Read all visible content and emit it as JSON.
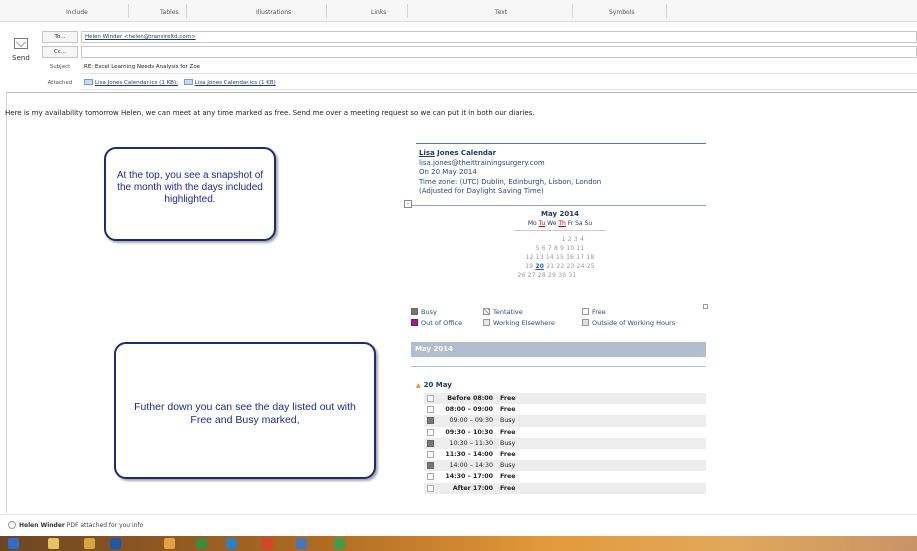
{
  "ribbon": {
    "groups": [
      "Include",
      "Tables",
      "Illustrations",
      "Links",
      "Text",
      "Symbols"
    ]
  },
  "compose": {
    "send_label": "Send",
    "to_label": "To...",
    "to_value": "Helen Winder <helen@transireltd.com>",
    "cc_label": "Cc...",
    "cc_value": "",
    "subject_label": "Subject",
    "subject_value": "RE: Excel Learning Needs Analysis for Zoe",
    "attached_label": "Attached",
    "attachments": [
      "Lisa Jones Calendar.ics (1 KB);",
      "Lisa Jones Calendar.ics (1 KB)"
    ]
  },
  "message": {
    "text": "Here is my availability tomorrow  Helen, we can meet at any time marked as free. Send me over a meeting request so we can put it in both our diaries."
  },
  "callouts": [
    "At the top, you see a snapshot of the month with the days included highlighted.",
    "Futher down you can see the day listed out with Free and Busy marked,"
  ],
  "calendar": {
    "name_first": "Lisa",
    "name_rest": " Jones Calendar",
    "email": "lisa.jones@theittrainingsurgery.com",
    "date_line": "On 20 May 2014",
    "timezone": "Time zone: (UTC) Dublin, Edinburgh, Lisbon, London",
    "dst_note": "(Adjusted for Daylight Saving Time)",
    "collapse_glyph": "-",
    "mini_month": {
      "title": "May 2014",
      "days": [
        "Mo",
        "Tu",
        "We",
        "Th",
        "Fr",
        "Sa",
        "Su"
      ],
      "highlighted_days": [
        "Tu",
        "Th"
      ],
      "weeks": [
        "1  2  3  4",
        "5  6  7  8  9 10 11",
        "12 13 14 15 16 17 18",
        "19 20 21 22 23 24 25",
        "26 27 28 29 30 31"
      ],
      "selected": "20"
    },
    "legend": {
      "busy": "Busy",
      "tentative": "Tentative",
      "free": "Free",
      "out_of_office": "Out of Office",
      "working_elsewhere": "Working Elsewhere",
      "outside_hours": "Outside of Working Hours"
    },
    "month_bar": "May 2014",
    "day_header": "20 May",
    "slots": [
      {
        "time": "Before 08:00",
        "status": "Free",
        "type": "free",
        "bold": true
      },
      {
        "time": "08:00 – 09:00",
        "status": "Free",
        "type": "free",
        "bold": true
      },
      {
        "time": "09:00 – 09:30",
        "status": "Busy",
        "type": "busy",
        "bold": false
      },
      {
        "time": "09:30 – 10:30",
        "status": "Free",
        "type": "free",
        "bold": true
      },
      {
        "time": "10:30 – 11:30",
        "status": "Busy",
        "type": "busy",
        "bold": false
      },
      {
        "time": "11:30 – 14:00",
        "status": "Free",
        "type": "free",
        "bold": true
      },
      {
        "time": "14:00 – 14:30",
        "status": "Busy",
        "type": "busy",
        "bold": false
      },
      {
        "time": "14:30 – 17:00",
        "status": "Free",
        "type": "free",
        "bold": true
      },
      {
        "time": "After 17:00",
        "status": "Free",
        "type": "free",
        "bold": true
      }
    ],
    "colors": {
      "busy": "#777777",
      "out_of_office": "#9b1f8f",
      "month_bar": "#b2bdd0",
      "accent": "#1f3a6b"
    }
  },
  "status_bar": {
    "name": "Helen Winder",
    "text": " PDF attached for you info"
  },
  "taskbar": {
    "icons": [
      "ie-icon",
      "folder-icon",
      "outlook-icon",
      "media-icon",
      "chrome-icon",
      "firefox-icon",
      "skype-icon",
      "word-icon",
      "excel-icon"
    ]
  }
}
